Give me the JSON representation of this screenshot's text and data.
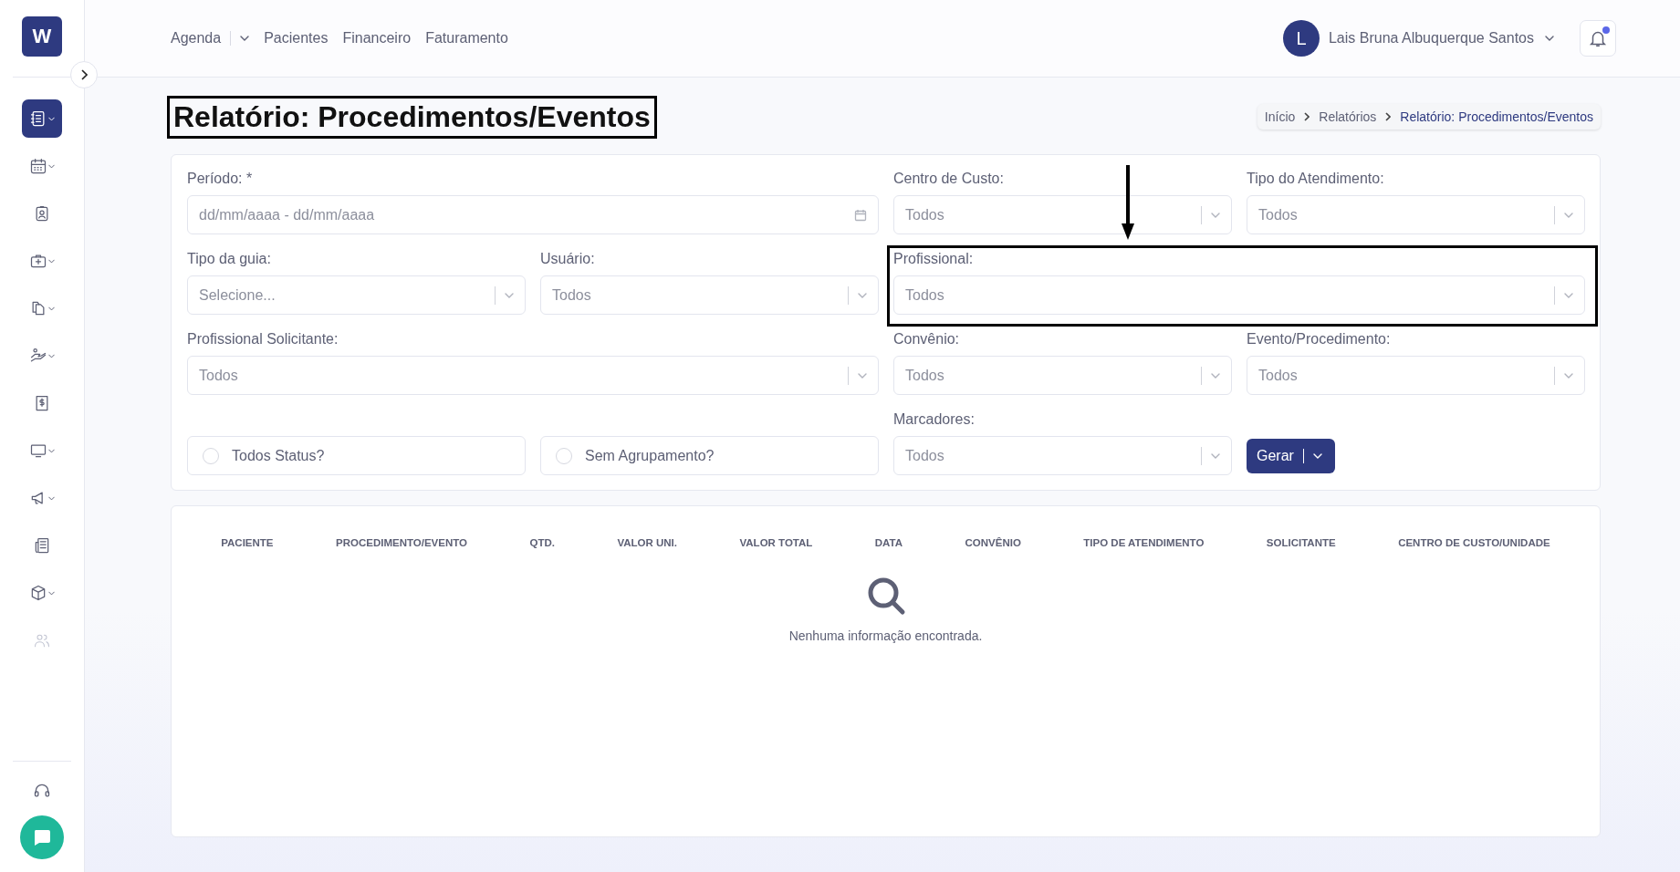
{
  "sidebar": {
    "logo": "W",
    "items": [
      {
        "kind": "notebook",
        "selected": true,
        "submenu": true,
        "disabled": false
      },
      {
        "kind": "calendar",
        "selected": false,
        "submenu": true,
        "disabled": false
      },
      {
        "kind": "badge",
        "selected": false,
        "submenu": false,
        "disabled": false
      },
      {
        "kind": "medkit",
        "selected": false,
        "submenu": true,
        "disabled": false
      },
      {
        "kind": "files",
        "selected": false,
        "submenu": true,
        "disabled": false
      },
      {
        "kind": "hand",
        "selected": false,
        "submenu": true,
        "disabled": false
      },
      {
        "kind": "invoice",
        "selected": false,
        "submenu": false,
        "disabled": false
      },
      {
        "kind": "monitor",
        "selected": false,
        "submenu": true,
        "disabled": false
      },
      {
        "kind": "megaphone",
        "selected": false,
        "submenu": true,
        "disabled": false
      },
      {
        "kind": "newspaper",
        "selected": false,
        "submenu": false,
        "disabled": false
      },
      {
        "kind": "box",
        "selected": false,
        "submenu": true,
        "disabled": false
      },
      {
        "kind": "people",
        "selected": false,
        "submenu": false,
        "disabled": true
      }
    ]
  },
  "nav": [
    {
      "label": "Agenda",
      "dropdown": true
    },
    {
      "label": "Pacientes",
      "dropdown": false
    },
    {
      "label": "Financeiro",
      "dropdown": false
    },
    {
      "label": "Faturamento",
      "dropdown": false
    }
  ],
  "user": {
    "initial": "L",
    "name": "Lais Bruna Albuquerque Santos",
    "has_notification": true
  },
  "page_title": {
    "text": "Relatório: Procedimentos/Eventos",
    "highlighted": true
  },
  "breadcrumb": [
    {
      "label": "Início",
      "current": false
    },
    {
      "label": "Relatórios",
      "current": false
    },
    {
      "label": "Relatório: Procedimentos/Eventos",
      "current": true
    }
  ],
  "filters": [
    {
      "kind": "date",
      "label": "Período: *",
      "placeholder": "dd/mm/aaaa - dd/mm/aaaa",
      "highlighted": false
    },
    {
      "kind": "select",
      "label": "Centro de Custo:",
      "placeholder": "Todos",
      "highlighted": false
    },
    {
      "kind": "select",
      "label": "Tipo do Atendimento:",
      "placeholder": "Todos",
      "highlighted": false
    },
    {
      "kind": "select",
      "label": "Tipo da guia:",
      "placeholder": "Selecione...",
      "highlighted": false
    },
    {
      "kind": "select",
      "label": "Usuário:",
      "placeholder": "Todos",
      "highlighted": false
    },
    {
      "kind": "select",
      "label": "Profissional:",
      "placeholder": "Todos",
      "highlighted": true
    },
    {
      "kind": "select",
      "label": "Profissional Solicitante:",
      "placeholder": "Todos",
      "highlighted": false
    },
    {
      "kind": "select",
      "label": "Convênio:",
      "placeholder": "Todos",
      "highlighted": false
    },
    {
      "kind": "select",
      "label": "Evento/Procedimento:",
      "placeholder": "Todos",
      "highlighted": false
    },
    {
      "kind": "checkbox",
      "label": "Todos Status?",
      "checked": false
    },
    {
      "kind": "checkbox",
      "label": "Sem Agrupamento?",
      "checked": false
    },
    {
      "kind": "select",
      "label": "Marcadores:",
      "placeholder": "Todos",
      "highlighted": false
    },
    {
      "kind": "button",
      "label": "Gerar",
      "dropdown": true
    }
  ],
  "table": {
    "columns": [
      "PACIENTE",
      "PROCEDIMENTO/EVENTO",
      "QTD.",
      "VALOR UNI.",
      "VALOR TOTAL",
      "DATA",
      "CONVÊNIO",
      "TIPO DE ATENDIMENTO",
      "SOLICITANTE",
      "CENTRO DE CUSTO/UNIDADE"
    ],
    "empty_message": "Nenhuma informação encontrada."
  }
}
